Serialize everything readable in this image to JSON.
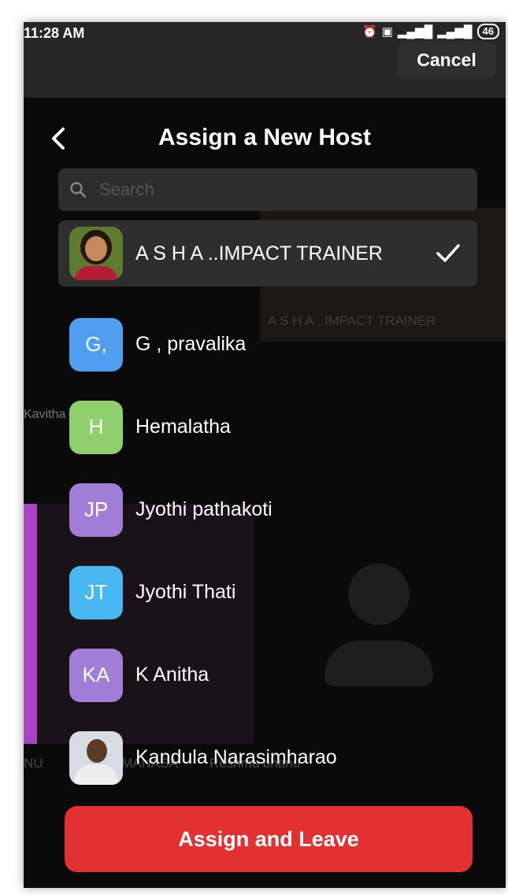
{
  "status_bar": {
    "time": "11:28 AM",
    "battery": "46",
    "icons": [
      "alarm-icon",
      "volte-icon",
      "signal-icon",
      "signal-icon"
    ]
  },
  "top_bar": {
    "cancel_label": "Cancel"
  },
  "background": {
    "tile_label": "A S H A ..IMPACT TRAINER",
    "side_label": "Kavitha",
    "bottom_labels": [
      "NU",
      "THULA MANASA",
      "Reshma bhanu"
    ]
  },
  "sheet": {
    "title": "Assign a New Host",
    "search_placeholder": "Search",
    "participants": [
      {
        "name": "A S H A ..IMPACT TRAINER",
        "avatar": "photo",
        "selected": true
      },
      {
        "name": "G , pravalika",
        "initials": "G,",
        "color": "#4f9ef0"
      },
      {
        "name": "Hemalatha",
        "initials": "H",
        "color": "#8fcf6c"
      },
      {
        "name": "Jyothi pathakoti",
        "initials": "JP",
        "color": "#a07ed8"
      },
      {
        "name": "Jyothi Thati",
        "initials": "JT",
        "color": "#48b6f0"
      },
      {
        "name": "K Anitha",
        "initials": "KA",
        "color": "#a07ed8"
      },
      {
        "name": "Kandula Narasimharao",
        "avatar": "photo"
      }
    ],
    "assign_button": "Assign and Leave"
  },
  "colors": {
    "accent_red": "#e33131",
    "background": "#0a0a0a",
    "selected_row": "#2e2e2e"
  }
}
